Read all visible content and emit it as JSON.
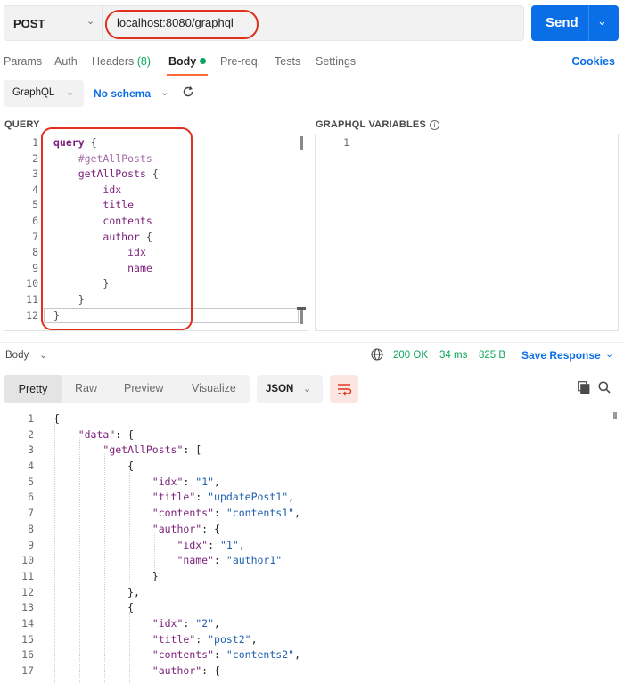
{
  "request": {
    "method": "POST",
    "url": "localhost:8080/graphql",
    "send_label": "Send"
  },
  "tabs": {
    "params": "Params",
    "auth": "Auth",
    "headers": "Headers",
    "headers_count": "(8)",
    "body": "Body",
    "prereq": "Pre-req.",
    "tests": "Tests",
    "settings": "Settings",
    "cookies": "Cookies"
  },
  "body_options": {
    "mode": "GraphQL",
    "schema": "No schema"
  },
  "sections": {
    "query": "QUERY",
    "variables": "GRAPHQL VARIABLES"
  },
  "query_lines": [
    "query {",
    "    #getAllPosts",
    "    getAllPosts {",
    "        idx",
    "        title",
    "        contents",
    "        author {",
    "            idx",
    "            name",
    "        }",
    "    }",
    "}"
  ],
  "variables_lines": [
    ""
  ],
  "response": {
    "body_label": "Body",
    "status": "200 OK",
    "time": "34 ms",
    "size": "825 B",
    "save_label": "Save Response",
    "view_tabs": [
      "Pretty",
      "Raw",
      "Preview",
      "Visualize"
    ],
    "format": "JSON"
  },
  "response_lines": [
    "{",
    "    \"data\": {",
    "        \"getAllPosts\": [",
    "            {",
    "                \"idx\": \"1\",",
    "                \"title\": \"updatePost1\",",
    "                \"contents\": \"contents1\",",
    "                \"author\": {",
    "                    \"idx\": \"1\",",
    "                    \"name\": \"author1\"",
    "                }",
    "            },",
    "            {",
    "                \"idx\": \"2\",",
    "                \"title\": \"post2\",",
    "                \"contents\": \"contents2\",",
    "                \"author\": {"
  ],
  "colors": {
    "accent": "#0a6ee6",
    "active_tab": "#ff6c37",
    "success": "#0aa55a",
    "highlight": "#e0301e"
  }
}
